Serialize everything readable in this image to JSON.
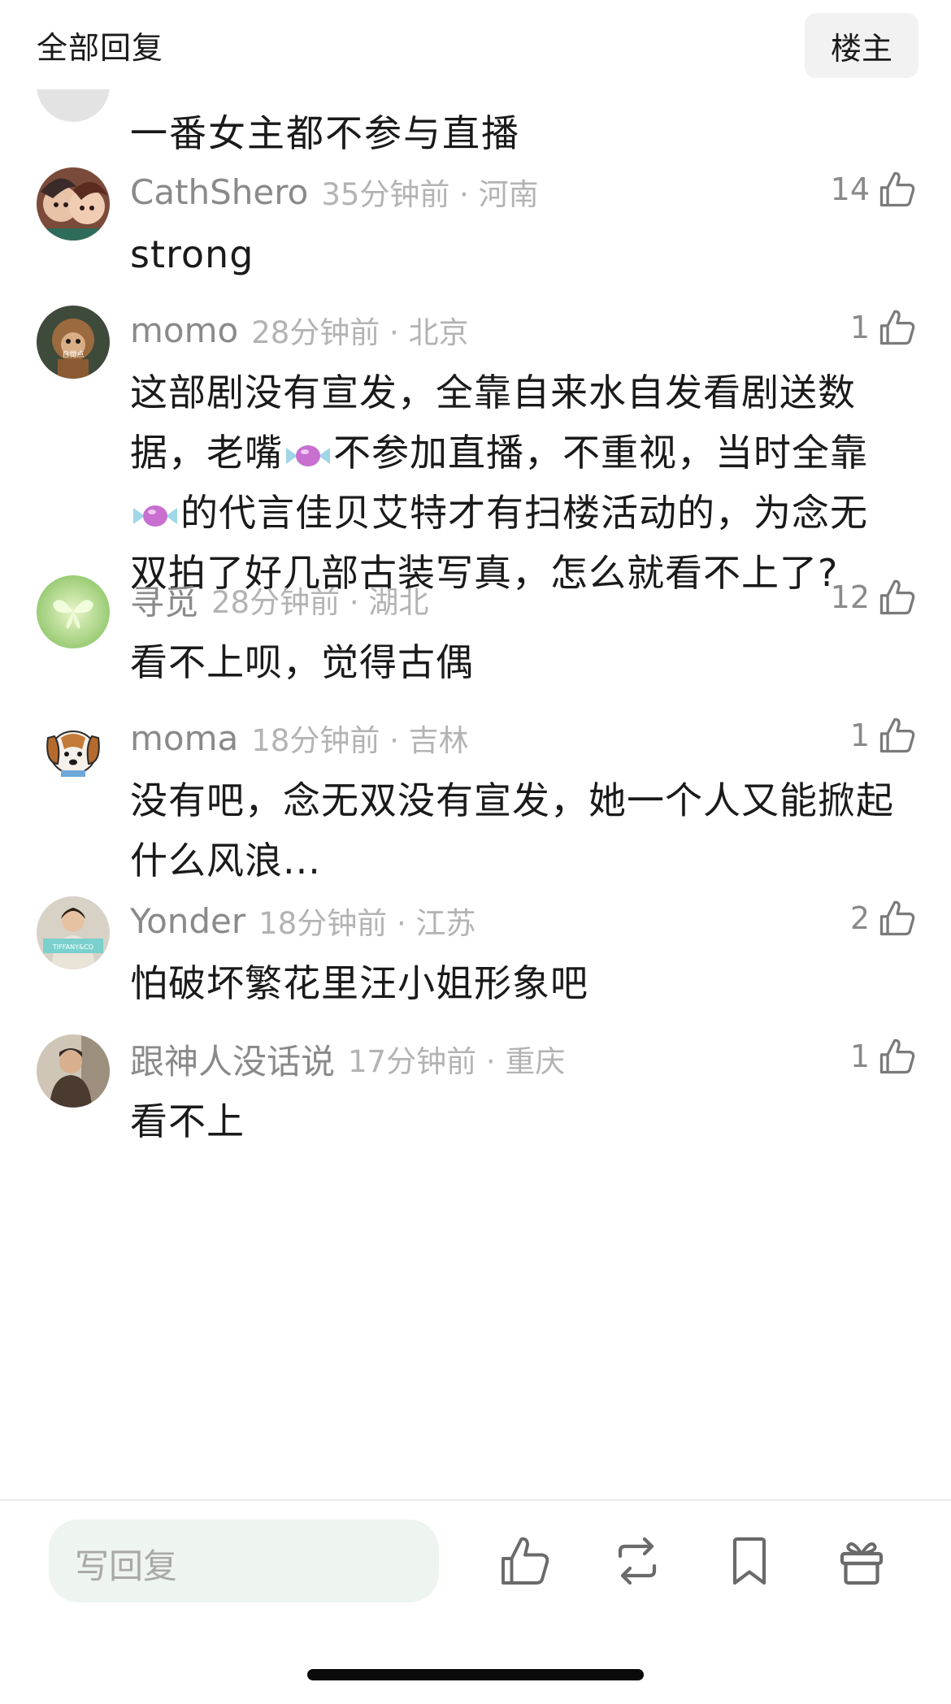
{
  "header": {
    "title": "全部回复",
    "op_button": "楼主"
  },
  "previous_comment": {
    "text": "一番女主都不参与直播"
  },
  "comments": [
    {
      "user": "CathShero",
      "time_loc": "35分钟前 · 河南",
      "likes": "14",
      "text": "strong",
      "avatar_icon": "anime-couple-avatar"
    },
    {
      "user": "momo",
      "time_loc": "28分钟前 · 北京",
      "likes": "1",
      "text_parts": [
        "这部剧没有宣发，全靠自来水自发看剧送数据，老嘴",
        "不参加直播，不重视，当时全靠",
        "的代言佳贝艾特才有扫楼活动的，为念无双拍了好几部古装写真，怎么就看不上了?"
      ],
      "emoji_icon": "candy-emoji",
      "avatar_icon": "monkey-avatar",
      "avatar_label": "自觉点"
    },
    {
      "user": "寻觅",
      "time_loc": "28分钟前 · 湖北",
      "likes": "12",
      "text": "看不上呗，觉得古偶",
      "avatar_icon": "butterfly-avatar"
    },
    {
      "user": "moma",
      "time_loc": "18分钟前 · 吉林",
      "likes": "1",
      "text": "没有吧，念无双没有宣发，她一个人又能掀起什么风浪...",
      "avatar_icon": "dog-avatar"
    },
    {
      "user": "Yonder",
      "time_loc": "18分钟前 · 江苏",
      "likes": "2",
      "text": "怕破坏繁花里汪小姐形象吧",
      "avatar_icon": "woman-photo-avatar",
      "avatar_label": "TIFFANY&CO"
    },
    {
      "user": "跟神人没话说",
      "time_loc": "17分钟前 · 重庆",
      "likes": "1",
      "text": "看不上",
      "avatar_icon": "man-photo-avatar"
    }
  ],
  "bottom_bar": {
    "reply_placeholder": "写回复",
    "actions": [
      "like-icon",
      "repost-icon",
      "bookmark-icon",
      "gift-icon"
    ]
  },
  "colors": {
    "username": "#8a8a8a",
    "meta": "#b3b3b3",
    "reply_box": "#eef5f0"
  }
}
